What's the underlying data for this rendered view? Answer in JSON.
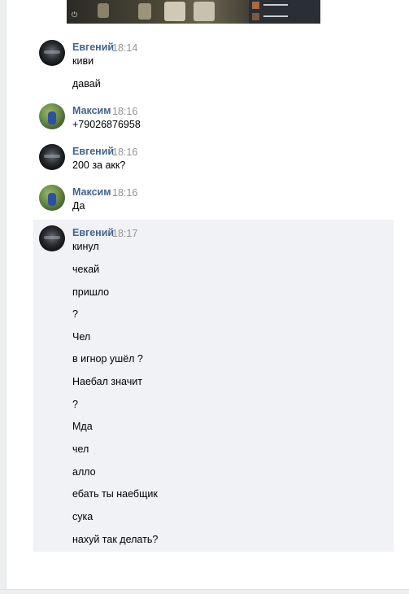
{
  "attachment": {
    "power_glyph": "⏻"
  },
  "messages": [
    {
      "author": "Евгений",
      "time": "18:14",
      "avatar": "evgeny",
      "lines": [
        "киви",
        "давай"
      ]
    },
    {
      "author": "Максим",
      "time": "18:16",
      "avatar": "maksim",
      "lines": [
        "+79026876958"
      ]
    },
    {
      "author": "Евгений",
      "time": "18:16",
      "avatar": "evgeny",
      "lines": [
        "200 за акк?"
      ]
    },
    {
      "author": "Максим",
      "time": "18:16",
      "avatar": "maksim",
      "lines": [
        "Да"
      ]
    },
    {
      "author": "Евгений",
      "time": "18:17",
      "avatar": "evgeny",
      "highlighted": true,
      "lines": [
        "кинул",
        "чекай",
        "пришло",
        "?",
        "Чел",
        "в игнор ушёл ?",
        "Наебал значит",
        "?",
        "Мда",
        "чел",
        "алло",
        "ебать ты наебщик",
        "сука",
        "нахуй так делать?"
      ]
    }
  ]
}
